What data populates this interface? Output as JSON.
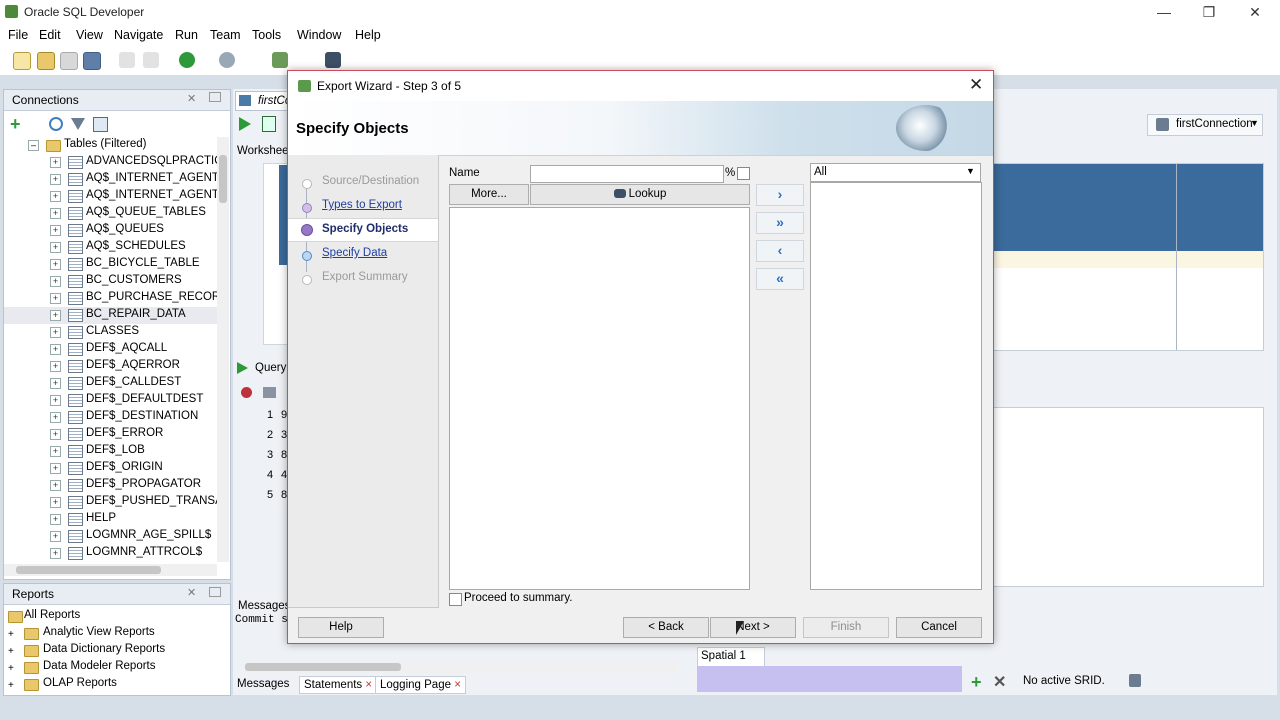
{
  "app": {
    "title": "Oracle SQL Developer"
  },
  "menu": [
    "File",
    "Edit",
    "View",
    "Navigate",
    "Run",
    "Team",
    "Tools",
    "Window",
    "Help"
  ],
  "connections": {
    "title": "Connections",
    "tables_node": "Tables (Filtered)",
    "tables": [
      "ADVANCEDSQLPRACTICE",
      "AQ$_INTERNET_AGENT_PF",
      "AQ$_INTERNET_AGENTS",
      "AQ$_QUEUE_TABLES",
      "AQ$_QUEUES",
      "AQ$_SCHEDULES",
      "BC_BICYCLE_TABLE",
      "BC_CUSTOMERS",
      "BC_PURCHASE_RECORDS",
      "BC_REPAIR_DATA",
      "CLASSES",
      "DEF$_AQCALL",
      "DEF$_AQERROR",
      "DEF$_CALLDEST",
      "DEF$_DEFAULTDEST",
      "DEF$_DESTINATION",
      "DEF$_ERROR",
      "DEF$_LOB",
      "DEF$_ORIGIN",
      "DEF$_PROPAGATOR",
      "DEF$_PUSHED_TRANSACTI",
      "HELP",
      "LOGMNR_AGE_SPILL$",
      "LOGMNR_ATTRCOL$"
    ]
  },
  "reports": {
    "title": "Reports",
    "items": [
      "All Reports",
      "Analytic View Reports",
      "Data Dictionary Reports",
      "Data Modeler Reports",
      "OLAP Reports"
    ]
  },
  "worksheet": {
    "tab": "firstCo",
    "sub_tab": "Worksheet",
    "query_tab": "Query",
    "connection": "firstConnection",
    "row_numbers": [
      "1",
      "2",
      "3",
      "4",
      "5"
    ],
    "row_prefix": [
      "9",
      "3",
      "8",
      "4",
      "8"
    ],
    "messages_title": "Messages",
    "messages_text": "Commit s",
    "bottom_tabs": [
      "Messages",
      "Statements",
      "Logging Page"
    ],
    "spatial_tab": "Spatial 1",
    "srid_status": "No active SRID."
  },
  "dialog": {
    "title": "Export Wizard - Step 3 of 5",
    "heading": "Specify Objects",
    "steps": [
      {
        "label": "Source/Destination",
        "state": "disabled"
      },
      {
        "label": "Types to Export",
        "state": "link"
      },
      {
        "label": "Specify Objects",
        "state": "current"
      },
      {
        "label": "Specify Data",
        "state": "link"
      },
      {
        "label": "Export Summary",
        "state": "disabled"
      }
    ],
    "name_label": "Name",
    "name_value": "",
    "percent_label": "%",
    "more_label": "More...",
    "lookup_label": "Lookup",
    "type_select": "All",
    "proceed_label": "Proceed to summary.",
    "buttons": {
      "help": "Help",
      "back": "< Back",
      "next": "Next >",
      "finish": "Finish",
      "cancel": "Cancel"
    }
  },
  "colors": {
    "accent": "#3b6a9c",
    "dialog_border": "#cf4a5a",
    "link": "#1f3ea0"
  }
}
